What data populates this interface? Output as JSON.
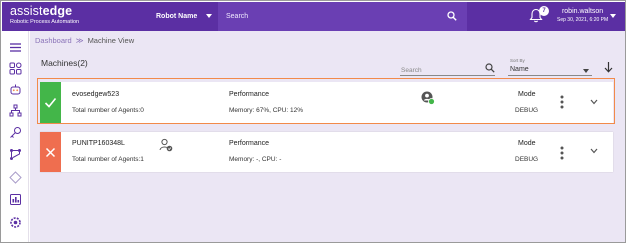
{
  "header": {
    "logo_main_thin": "assist",
    "logo_main_bold": "edge",
    "logo_sub": "Robotic Process Automation",
    "robot_select_label": "Robot Name",
    "search_placeholder": "Search",
    "notification_count": "7",
    "user_name": "robin.waltson",
    "user_date": "Sep 30, 2021, 6:20 PM"
  },
  "breadcrumb": {
    "root": "Dashboard",
    "separator": "≫",
    "current": "Machine View"
  },
  "machines": {
    "title": "Machines(2)",
    "search_placeholder": "Search",
    "sort_caption": "Sort By",
    "sort_value": "Name",
    "items": [
      {
        "name": "evosedgew523",
        "agents": "Total number of Agents:0",
        "perf_title": "Performance",
        "perf_value": "Memory: 67%, CPU: 12%",
        "mode_title": "Mode",
        "mode_value": "DEBUG",
        "status": "ok"
      },
      {
        "name": "PUNITP160348L",
        "agents": "Total number of Agents:1",
        "perf_title": "Performance",
        "perf_value": "Memory: -, CPU: -",
        "mode_title": "Mode",
        "mode_value": "DEBUG",
        "status": "error"
      }
    ]
  },
  "colors": {
    "brand": "#5b2fa3",
    "ok": "#43b649",
    "error": "#ef6e4f",
    "highlight": "#f28a4a"
  }
}
